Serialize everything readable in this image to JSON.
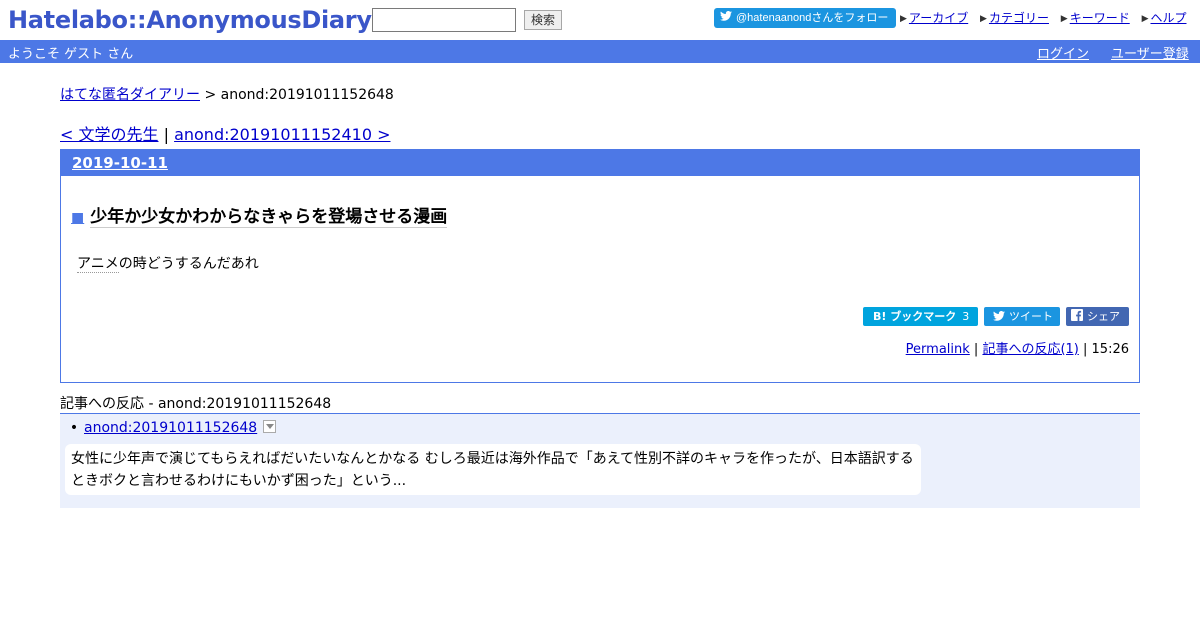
{
  "header": {
    "logo": "Hatelabo::AnonymousDiary",
    "search": {
      "value": "",
      "button_label": "検索"
    },
    "follow_button": "@hatenaanondさんをフォロー",
    "links": [
      {
        "label": "アーカイブ"
      },
      {
        "label": "カテゴリー"
      },
      {
        "label": "キーワード"
      },
      {
        "label": "ヘルプ"
      }
    ]
  },
  "userbar": {
    "welcome": "ようこそ ゲスト さん",
    "login": "ログイン",
    "register": "ユーザー登録"
  },
  "breadcrumb": {
    "home": "はてな匿名ダイアリー",
    "separator": " > ",
    "current": "anond:20191011152648"
  },
  "nav": {
    "prev": "< 文学の先生",
    "separator": " | ",
    "next": "anond:20191011152410 >"
  },
  "entry": {
    "date": "2019-10-11",
    "square": "■",
    "title": "少年か少女かわからなきゃらを登場させる漫画",
    "body_keyword": "アニメ",
    "body_rest": "の時どうするんだあれ",
    "share": {
      "bookmark_label": "B! ブックマーク",
      "bookmark_count": "3",
      "tweet_label": "ツイート",
      "share_label": "シェア"
    },
    "footer": {
      "permalink": "Permalink",
      "sep1": " | ",
      "reactions_link": "記事への反応(1)",
      "sep2": " | ",
      "time": "15:26"
    }
  },
  "reactions": {
    "heading": "記事への反応 - anond:20191011152648",
    "items": [
      {
        "bullet": "•",
        "link": "anond:20191011152648",
        "excerpt": "女性に少年声で演じてもらえればだいたいなんとかなる むしろ最近は海外作品で「あえて性別不詳のキャラを作ったが、日本語訳するときボクと言わせるわけにもいかず困った」という..."
      }
    ]
  },
  "colors": {
    "brand_blue": "#4d78e6",
    "logo_blue": "#3a56c9",
    "link": "#0000cc",
    "twitter": "#1b95e0",
    "hatena_bookmark": "#00a4de",
    "facebook": "#4267b2",
    "reaction_bg": "#ebf0fc"
  },
  "icons": [
    "twitter-bird-icon",
    "arrow-icon",
    "facebook-icon",
    "dropdown-toggle-icon"
  ]
}
